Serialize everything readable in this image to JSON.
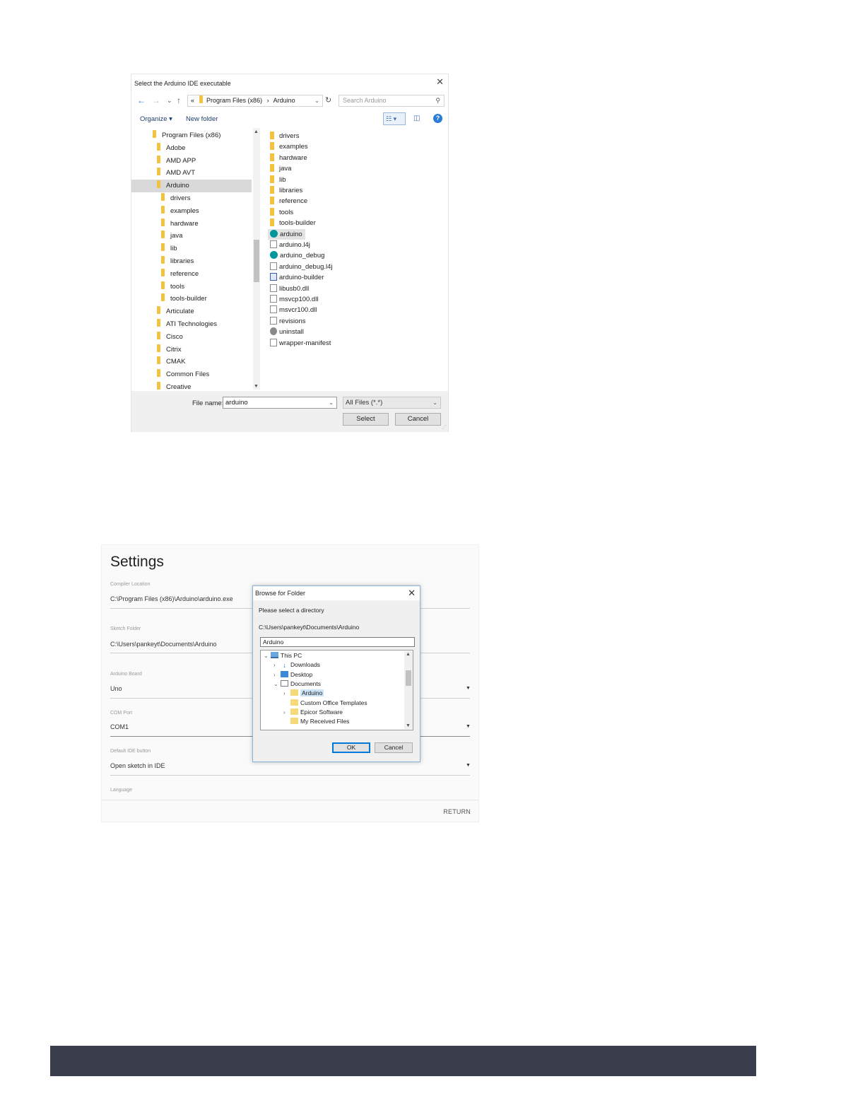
{
  "file_dialog": {
    "title": "Select the Arduino IDE executable",
    "nav": {
      "back": "←",
      "forward": "→",
      "recent": "⌄",
      "up": "↑"
    },
    "address": {
      "prefix": "«",
      "crumbs": [
        "Program Files (x86)",
        "Arduino"
      ],
      "separator": "›"
    },
    "search_placeholder": "Search Arduino",
    "toolbar": {
      "organize": "Organize ▾",
      "new_folder": "New folder"
    },
    "tree": [
      {
        "label": "Program Files (x86)",
        "level": 0
      },
      {
        "label": "Adobe",
        "level": 1
      },
      {
        "label": "AMD APP",
        "level": 1
      },
      {
        "label": "AMD AVT",
        "level": 1
      },
      {
        "label": "Arduino",
        "level": 1,
        "selected": true
      },
      {
        "label": "drivers",
        "level": 2
      },
      {
        "label": "examples",
        "level": 2
      },
      {
        "label": "hardware",
        "level": 2
      },
      {
        "label": "java",
        "level": 2
      },
      {
        "label": "lib",
        "level": 2
      },
      {
        "label": "libraries",
        "level": 2
      },
      {
        "label": "reference",
        "level": 2
      },
      {
        "label": "tools",
        "level": 2
      },
      {
        "label": "tools-builder",
        "level": 2
      },
      {
        "label": "Articulate",
        "level": 1
      },
      {
        "label": "ATI Technologies",
        "level": 1
      },
      {
        "label": "Cisco",
        "level": 1
      },
      {
        "label": "Citrix",
        "level": 1
      },
      {
        "label": "CMAK",
        "level": 1
      },
      {
        "label": "Common Files",
        "level": 1
      },
      {
        "label": "Creative",
        "level": 1
      }
    ],
    "files": [
      {
        "name": "drivers",
        "icon": "folder"
      },
      {
        "name": "examples",
        "icon": "folder"
      },
      {
        "name": "hardware",
        "icon": "folder"
      },
      {
        "name": "java",
        "icon": "folder"
      },
      {
        "name": "lib",
        "icon": "folder"
      },
      {
        "name": "libraries",
        "icon": "folder"
      },
      {
        "name": "reference",
        "icon": "folder"
      },
      {
        "name": "tools",
        "icon": "folder"
      },
      {
        "name": "tools-builder",
        "icon": "folder"
      },
      {
        "name": "arduino",
        "icon": "app",
        "selected": true
      },
      {
        "name": "arduino.l4j",
        "icon": "doc"
      },
      {
        "name": "arduino_debug",
        "icon": "app"
      },
      {
        "name": "arduino_debug.l4j",
        "icon": "doc"
      },
      {
        "name": "arduino-builder",
        "icon": "builder"
      },
      {
        "name": "libusb0.dll",
        "icon": "doc"
      },
      {
        "name": "msvcp100.dll",
        "icon": "doc"
      },
      {
        "name": "msvcr100.dll",
        "icon": "doc"
      },
      {
        "name": "revisions",
        "icon": "doc"
      },
      {
        "name": "uninstall",
        "icon": "uninstall"
      },
      {
        "name": "wrapper-manifest",
        "icon": "doc"
      }
    ],
    "file_name_label": "File name:",
    "file_name_value": "arduino",
    "file_type": "All Files (*.*)",
    "select_button": "Select",
    "cancel_button": "Cancel"
  },
  "settings": {
    "title": "Settings",
    "fields": [
      {
        "label": "Compiler Location",
        "value": "C:\\Program Files (x86)\\Arduino\\arduino.exe",
        "dropdown": false
      },
      {
        "label": "Sketch Folder",
        "value": "C:\\Users\\pankeyt\\Documents\\Arduino",
        "dropdown": false
      },
      {
        "label": "Arduino Board",
        "value": "Uno",
        "dropdown": true
      },
      {
        "label": "COM Port",
        "value": "COM1",
        "dropdown": true
      },
      {
        "label": "Default IDE button",
        "value": "Open sketch in IDE",
        "dropdown": true
      },
      {
        "label": "Language",
        "value": "",
        "dropdown": false
      }
    ],
    "return_button": "RETURN"
  },
  "browse_dialog": {
    "title": "Browse for Folder",
    "prompt": "Please select a directory",
    "path": "C:\\Users\\pankeyt\\Documents\\Arduino",
    "folder_input": "Arduino",
    "tree": [
      {
        "label": "This PC",
        "level": 0,
        "expander": "expanded",
        "icon": "pc"
      },
      {
        "label": "Downloads",
        "level": 1,
        "expander": "collapsed",
        "icon": "download"
      },
      {
        "label": "Desktop",
        "level": 1,
        "expander": "collapsed",
        "icon": "desktop"
      },
      {
        "label": "Documents",
        "level": 1,
        "expander": "expanded",
        "icon": "documents"
      },
      {
        "label": "Arduino",
        "level": 2,
        "expander": "collapsed",
        "icon": "folder",
        "selected": true
      },
      {
        "label": "Custom Office Templates",
        "level": 2,
        "expander": "none",
        "icon": "folder"
      },
      {
        "label": "Epicor Software",
        "level": 2,
        "expander": "collapsed",
        "icon": "folder"
      },
      {
        "label": "My Received Files",
        "level": 2,
        "expander": "none",
        "icon": "folder"
      }
    ],
    "ok_button": "OK",
    "cancel_button": "Cancel"
  },
  "colors": {
    "footer_band": "#3a3d4c",
    "folder": "#f3c23e",
    "selection": "#cce4f7",
    "accent": "#0078d7"
  }
}
